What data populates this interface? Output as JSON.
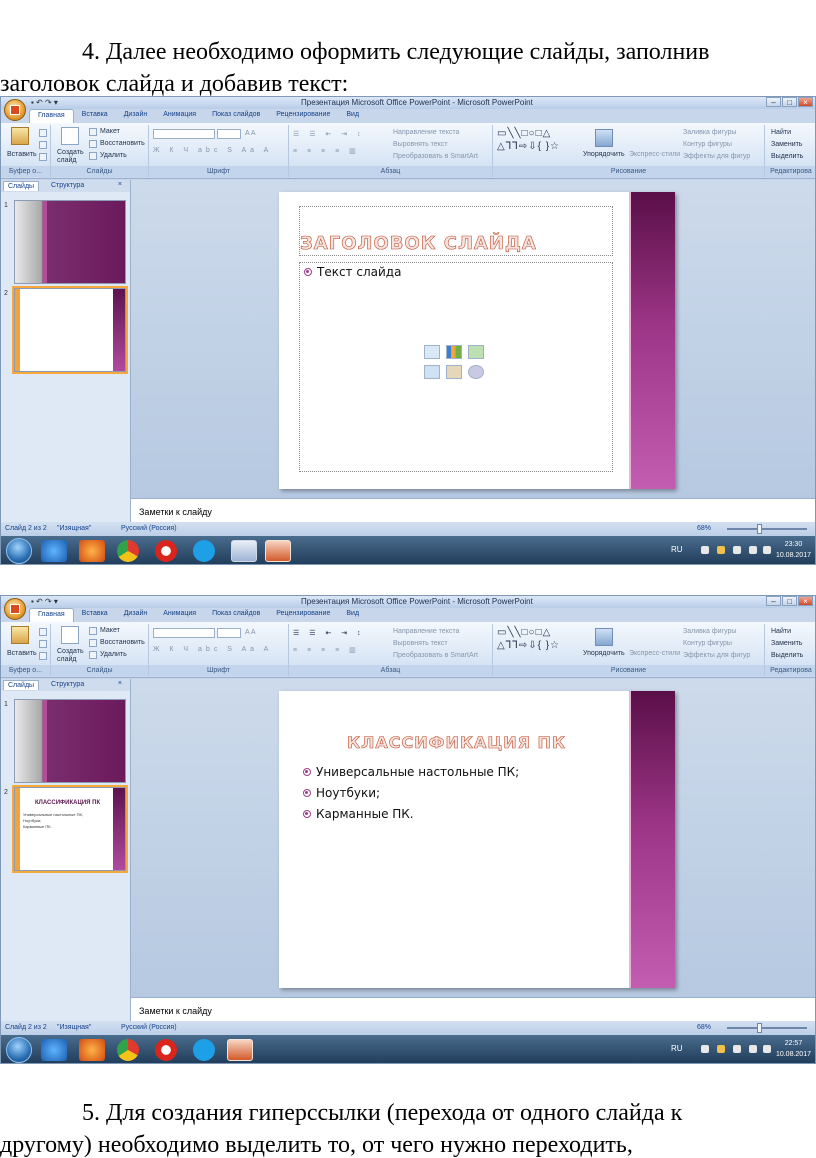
{
  "paragraphs": {
    "p1_line1": "4. Далее необходимо оформить следующие слайды, заполнив",
    "p1_line2": "заголовок слайда и добавив текст:",
    "p2_line1": "5. Для создания гиперссылки (перехода от одного слайда к",
    "p2_line2": "другому) необходимо выделить то, от чего нужно переходить,"
  },
  "app": {
    "window_title": "Презентация Microsoft Office PowerPoint - Microsoft PowerPoint",
    "tabs": [
      "Главная",
      "Вставка",
      "Дизайн",
      "Анимация",
      "Показ слайдов",
      "Рецензирование",
      "Вид"
    ],
    "ribbon": {
      "paste": "Вставить",
      "new_slide": "Создать слайд",
      "layout": "Макет",
      "reset": "Восстановить",
      "delete": "Удалить",
      "text_direction": "Направление текста",
      "align_text": "Выровнять текст",
      "convert_smartart": "Преобразовать в SmartArt",
      "arrange": "Упорядочить",
      "quick_styles": "Экспресс-стили",
      "shape_fill": "Заливка фигуры",
      "shape_outline": "Контур фигуры",
      "shape_effects": "Эффекты для фигур",
      "find": "Найти",
      "replace": "Заменить",
      "select": "Выделить",
      "groups": {
        "clipboard": "Буфер о...",
        "slides": "Слайды",
        "font": "Шрифт",
        "paragraph": "Абзац",
        "drawing": "Рисование",
        "editing": "Редактирова"
      }
    },
    "pane_tabs": {
      "slides": "Слайды",
      "outline": "Структура",
      "close": "×"
    },
    "notes_placeholder": "Заметки к слайду",
    "theme": "\"Изящная\"",
    "language": "Русский (Россия)",
    "zoom": "68%",
    "tray_lang": "RU"
  },
  "screens": [
    {
      "status_slide": "Слайд 2 из 2",
      "slide_title": "ЗАГОЛОВОК СЛАЙДА",
      "bullets": [
        "Текст слайда"
      ],
      "time": "23:30",
      "date": "10.08.2017"
    },
    {
      "status_slide": "Слайд 2 из 2",
      "slide_title": "КЛАССИФИКАЦИЯ ПК",
      "bullets": [
        "Универсальные настольные ПК;",
        "Ноутбуки;",
        "Карманные ПК."
      ],
      "time": "22:57",
      "date": "10.08.2017"
    }
  ],
  "thumbnails": {
    "slide1_num": "1",
    "slide2_num": "2"
  }
}
